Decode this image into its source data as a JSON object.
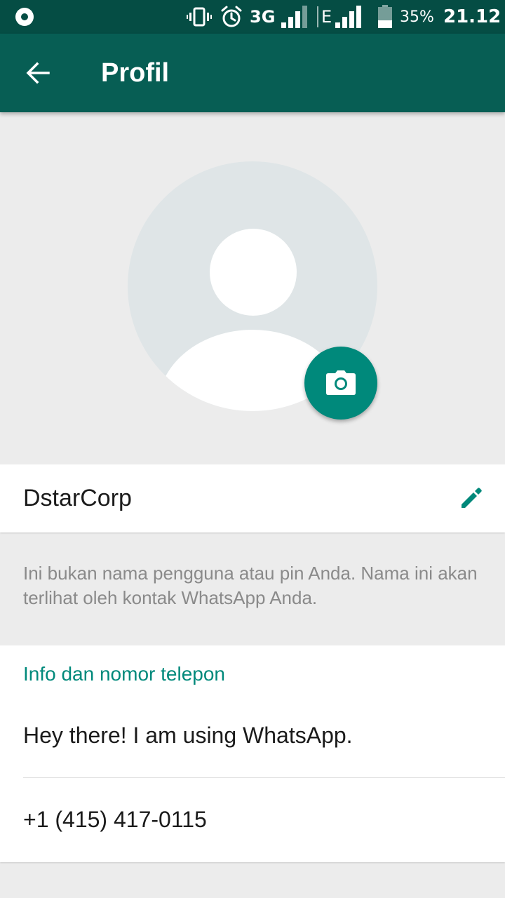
{
  "status_bar": {
    "network_3g": "3G",
    "network_e": "E",
    "battery": "35%",
    "time": "21.12",
    "icons": [
      "record-icon",
      "vibrate-icon",
      "alarm-icon",
      "signal-icon",
      "signal-icon",
      "battery-icon"
    ]
  },
  "toolbar": {
    "title": "Profil",
    "back_icon": "back-arrow-icon"
  },
  "profile": {
    "avatar_icon": "default-avatar-icon",
    "camera_icon": "camera-icon",
    "name": "DstarCorp",
    "edit_icon": "pencil-icon",
    "hint": "Ini bukan nama pengguna atau pin Anda. Nama ini akan terlihat oleh kontak WhatsApp Anda."
  },
  "info": {
    "heading": "Info dan nomor telepon",
    "about": "Hey there! I am using WhatsApp.",
    "phone": "+1 (415) 417-0115"
  },
  "colors": {
    "status_bar": "#054d44",
    "toolbar": "#075e54",
    "accent": "#00897b",
    "background": "#ececec"
  }
}
